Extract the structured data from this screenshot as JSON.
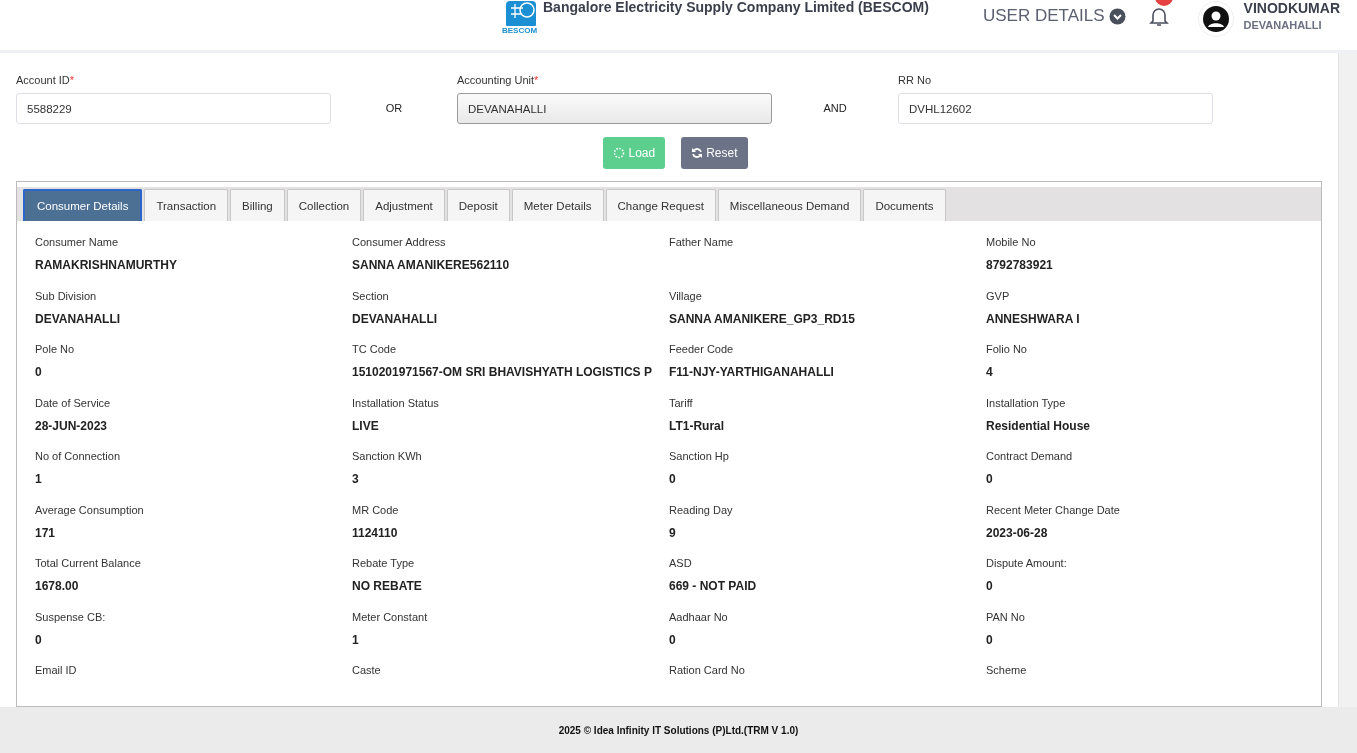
{
  "header": {
    "company": "Bangalore Electricity Supply Company Limited (BESCOM)",
    "logo_caption": "BESCOM",
    "user_details": "USER DETAILS",
    "user": {
      "name": "VINODKUMAR",
      "unit": "DEVANAHALLI"
    }
  },
  "search": {
    "fields": [
      {
        "label": "Account ID",
        "marker": "*",
        "value": "5588229",
        "disabled": false
      },
      {
        "label": "Accounting Unit",
        "marker": "*",
        "value": "DEVANAHALLI",
        "disabled": true
      },
      {
        "label": "RR No",
        "value": "DVHL12602",
        "disabled": false
      }
    ],
    "joiners": [
      "OR",
      "AND"
    ],
    "buttons": [
      {
        "label": "Load",
        "kind": "load"
      },
      {
        "label": "Reset",
        "kind": "reset"
      }
    ]
  },
  "tabs": [
    {
      "label": "Consumer Details",
      "selected": true
    },
    {
      "label": "Transaction",
      "selected": false
    },
    {
      "label": "Billing",
      "selected": false
    },
    {
      "label": "Collection",
      "selected": false
    },
    {
      "label": "Adjustment",
      "selected": false
    },
    {
      "label": "Deposit",
      "selected": false
    },
    {
      "label": "Meter Details",
      "selected": false
    },
    {
      "label": "Change Request",
      "selected": false
    },
    {
      "label": "Miscellaneous Demand",
      "selected": false
    },
    {
      "label": "Documents",
      "selected": false
    }
  ],
  "details": [
    {
      "label": "Consumer Name",
      "value": "RAMAKRISHNAMURTHY"
    },
    {
      "label": "Consumer Address",
      "value": "SANNA AMANIKERE562110"
    },
    {
      "label": "Father Name"
    },
    {
      "label": "Mobile No",
      "value": "8792783921"
    },
    {
      "label": "Sub Division",
      "value": "DEVANAHALLI"
    },
    {
      "label": "Section",
      "value": "DEVANAHALLI"
    },
    {
      "label": "Village",
      "value": "SANNA AMANIKERE_GP3_RD15"
    },
    {
      "label": "GVP",
      "value": "ANNESHWARA I"
    },
    {
      "label": "Pole No",
      "value": "0"
    },
    {
      "label": "TC Code",
      "value": "1510201971567-OM SRI BHAVISHYATH LOGISTICS P"
    },
    {
      "label": "Feeder Code",
      "value": "F11-NJY-YARTHIGANAHALLI"
    },
    {
      "label": "Folio No",
      "value": "4"
    },
    {
      "label": "Date of Service",
      "value": "28-JUN-2023"
    },
    {
      "label": "Installation Status",
      "value": "LIVE"
    },
    {
      "label": "Tariff",
      "value": "LT1-Rural"
    },
    {
      "label": "Installation Type",
      "value": "Residential House"
    },
    {
      "label": "No of Connection",
      "value": "1"
    },
    {
      "label": "Sanction KWh",
      "value": "3"
    },
    {
      "label": "Sanction Hp",
      "value": "0"
    },
    {
      "label": "Contract Demand",
      "value": "0"
    },
    {
      "label": "Average Consumption",
      "value": "171"
    },
    {
      "label": "MR Code",
      "value": "1124110"
    },
    {
      "label": "Reading Day",
      "value": "9"
    },
    {
      "label": "Recent Meter Change Date",
      "value": "2023-06-28"
    },
    {
      "label": "Total Current Balance",
      "value": "1678.00"
    },
    {
      "label": "Rebate Type",
      "value": "NO REBATE"
    },
    {
      "label": "ASD",
      "value": "669 - NOT PAID"
    },
    {
      "label": "Dispute Amount:",
      "value": "0"
    },
    {
      "label": "Suspense CB:",
      "value": "0"
    },
    {
      "label": "Meter Constant",
      "value": "1"
    },
    {
      "label": "Aadhaar No",
      "value": "0"
    },
    {
      "label": "PAN No",
      "value": "0"
    },
    {
      "label": "Email ID"
    },
    {
      "label": "Caste"
    },
    {
      "label": "Ration Card No"
    },
    {
      "label": "Scheme"
    }
  ],
  "footer": "2025 © Idea Infinity IT Solutions (P)Ltd.(TRM V 1.0)"
}
